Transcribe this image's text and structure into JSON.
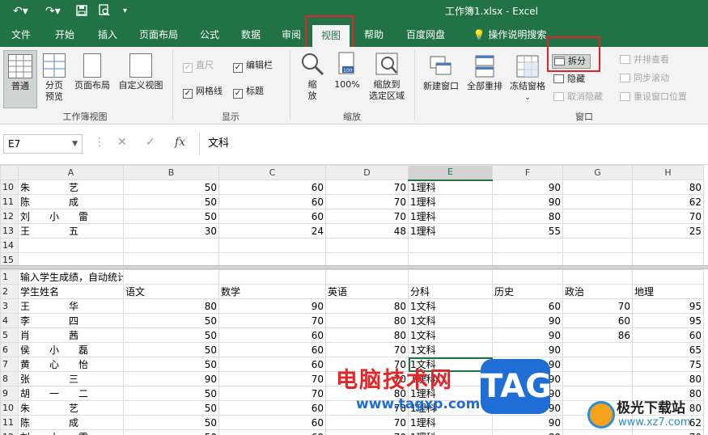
{
  "window": {
    "title": "工作簿1.xlsx  -  Excel",
    "accent": "#217346"
  },
  "quick_access": [
    "undo-icon",
    "redo-icon",
    "save-icon",
    "print-preview-icon",
    "customize-icon"
  ],
  "tabs": [
    "文件",
    "开始",
    "插入",
    "页面布局",
    "公式",
    "数据",
    "审阅",
    "视图",
    "帮助",
    "百度网盘"
  ],
  "active_tab": "视图",
  "tell_me": "操作说明搜索",
  "ribbon": {
    "workbook_views": {
      "label": "工作簿视图",
      "normal": "普通",
      "page_break_1": "分页",
      "page_break_2": "预览",
      "page_layout": "页面布局",
      "custom_views": "自定义视图"
    },
    "show": {
      "label": "显示",
      "ruler": "直尺",
      "formula_bar": "编辑栏",
      "gridlines": "网格线",
      "headings": "标题"
    },
    "zoom": {
      "label": "缩放",
      "zoom_1": "缩",
      "zoom_2": "放",
      "zoom_100": "100%",
      "zoom_sel_1": "缩放到",
      "zoom_sel_2": "选定区域"
    },
    "window": {
      "label": "窗口",
      "new_window": "新建窗口",
      "arrange_all": "全部重排",
      "freeze_panes": "冻结窗格",
      "split": "拆分",
      "hide": "隐藏",
      "unhide": "取消隐藏",
      "view_side": "并排查看",
      "sync_scroll": "同步滚动",
      "reset_pos": "重设窗口位置"
    }
  },
  "formula_bar": {
    "name_box": "E7",
    "content": "文科"
  },
  "columns": [
    "A",
    "B",
    "C",
    "D",
    "E",
    "F",
    "G",
    "H"
  ],
  "selected_column": "E",
  "top_pane": [
    {
      "row": "10",
      "cells": [
        "朱　　　　艺",
        "50",
        "60",
        "70",
        "1理科",
        "90",
        "",
        "80"
      ]
    },
    {
      "row": "11",
      "cells": [
        "陈　　　　成",
        "50",
        "60",
        "70",
        "1理科",
        "90",
        "",
        "62"
      ]
    },
    {
      "row": "12",
      "cells": [
        "刘　　小　　雷",
        "50",
        "60",
        "70",
        "1理科",
        "80",
        "",
        "70"
      ]
    },
    {
      "row": "13",
      "cells": [
        "王　　　　五",
        "30",
        "24",
        "48",
        "1理科",
        "55",
        "",
        "25"
      ]
    },
    {
      "row": "14",
      "cells": [
        "",
        "",
        "",
        "",
        "",
        "",
        "",
        ""
      ]
    },
    {
      "row": "15",
      "cells": [
        "",
        "",
        "",
        "",
        "",
        "",
        "",
        ""
      ]
    }
  ],
  "bottom_pane": [
    {
      "row": "1",
      "cells": [
        "输入学生成绩，自动统计学科的平均分等数据。班级：X年X班统计日期：X年X月X日",
        "",
        "",
        "",
        "",
        "",
        "",
        ""
      ]
    },
    {
      "row": "2",
      "cells": [
        "学生姓名",
        "语文",
        "数学",
        "英语",
        "分科",
        "历史",
        "政治",
        "地理"
      ]
    },
    {
      "row": "3",
      "cells": [
        "王　　　　华",
        "80",
        "90",
        "80",
        "1文科",
        "60",
        "70",
        "95"
      ]
    },
    {
      "row": "4",
      "cells": [
        "李　　　　四",
        "50",
        "70",
        "80",
        "1文科",
        "90",
        "60",
        "95"
      ]
    },
    {
      "row": "5",
      "cells": [
        "肖　　　　茜",
        "50",
        "60",
        "80",
        "1文科",
        "90",
        "86",
        "60"
      ]
    },
    {
      "row": "6",
      "cells": [
        "侯　　小　　磊",
        "50",
        "60",
        "70",
        "1文科",
        "90",
        "",
        "65"
      ]
    },
    {
      "row": "7",
      "cells": [
        "黄　　心　　怡",
        "50",
        "60",
        "70",
        "1文科",
        "90",
        "",
        "75"
      ]
    },
    {
      "row": "8",
      "cells": [
        "张　　　　三",
        "90",
        "70",
        "70",
        "1理科",
        "90",
        "",
        "80"
      ]
    },
    {
      "row": "9",
      "cells": [
        "胡　　一　　二",
        "50",
        "70",
        "80",
        "1理科",
        "90",
        "",
        "80"
      ]
    },
    {
      "row": "10",
      "cells": [
        "朱　　　　艺",
        "50",
        "60",
        "70",
        "1理科",
        "90",
        "",
        "80"
      ]
    },
    {
      "row": "11",
      "cells": [
        "陈　　　　成",
        "50",
        "60",
        "70",
        "1理科",
        "90",
        "",
        "62"
      ]
    },
    {
      "row": "12",
      "cells": [
        "刘　　小　　雷",
        "50",
        "60",
        "70",
        "1理科",
        "80",
        "",
        "70"
      ]
    }
  ],
  "watermarks": {
    "site_cn": "电脑技术网",
    "site_url": "www.tagxp.com",
    "tag": "TAG",
    "brand": "极光下载站",
    "brand_url": "www.xz7.com"
  }
}
